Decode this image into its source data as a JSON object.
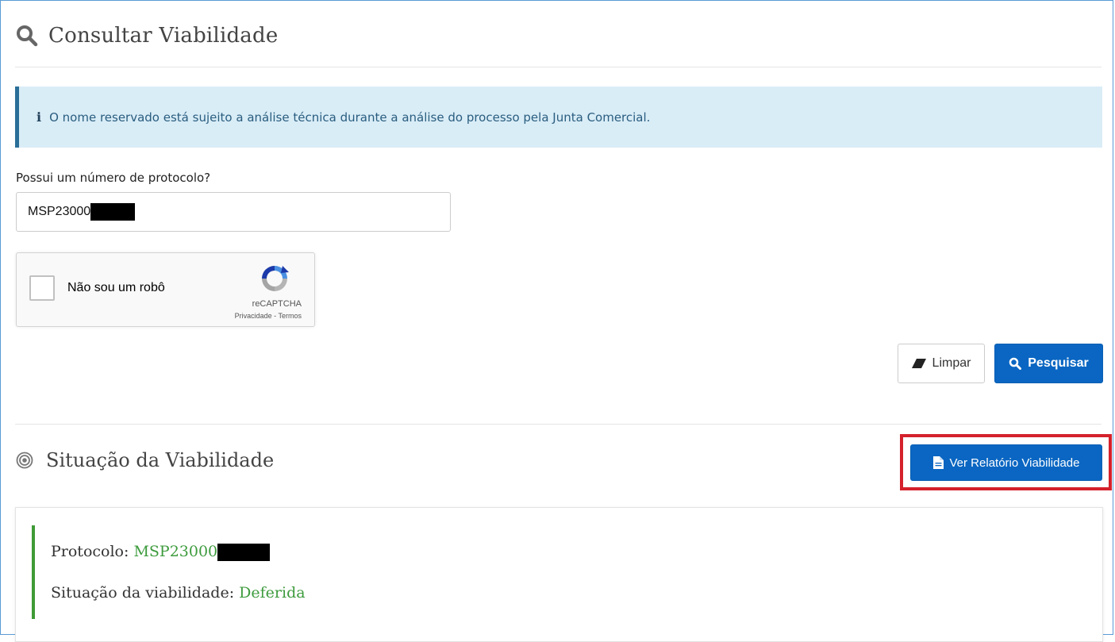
{
  "header": {
    "title": "Consultar Viabilidade",
    "icon": "search-icon"
  },
  "alert": {
    "icon": "info-icon",
    "icon_glyph": "i",
    "message": "O nome reservado está sujeito a análise técnica durante a análise do processo pela Junta Comercial."
  },
  "form": {
    "protocol_label": "Possui um número de protocolo?",
    "protocol_value": "MSP23000"
  },
  "captcha": {
    "label": "Não sou um robô",
    "brand": "reCAPTCHA",
    "terms": "Privacidade - Termos"
  },
  "buttons": {
    "clear_label": "Limpar",
    "search_label": "Pesquisar",
    "report_label": "Ver Relatório Viabilidade"
  },
  "result": {
    "section_title": "Situação da Viabilidade",
    "protocol_label": "Protocolo:",
    "protocol_value": "MSP23000",
    "status_label": "Situação da viabilidade:",
    "status_value": "Deferida"
  },
  "colors": {
    "primary": "#0a66c2",
    "success": "#3d9b3d",
    "alert_bg": "#d9edf7",
    "highlight": "#d4212b"
  }
}
